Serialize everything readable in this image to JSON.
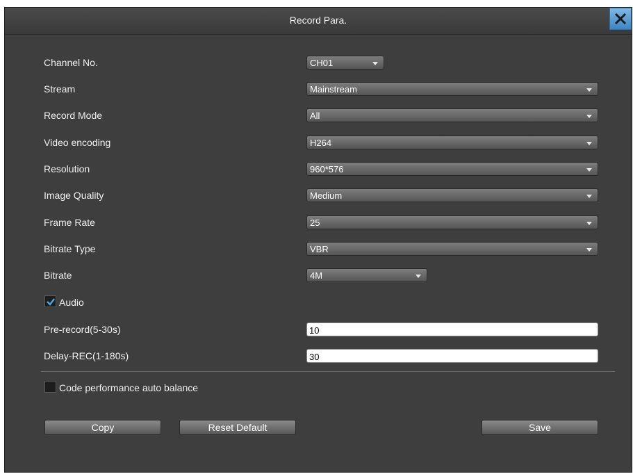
{
  "window": {
    "title": "Record Para."
  },
  "fields": {
    "channel_no": {
      "label": "Channel No.",
      "value": "CH01"
    },
    "stream": {
      "label": "Stream",
      "value": "Mainstream"
    },
    "record_mode": {
      "label": "Record Mode",
      "value": "All"
    },
    "video_encoding": {
      "label": "Video encoding",
      "value": "H264"
    },
    "resolution": {
      "label": "Resolution",
      "value": "960*576"
    },
    "image_quality": {
      "label": "Image Quality",
      "value": "Medium"
    },
    "frame_rate": {
      "label": "Frame Rate",
      "value": "25"
    },
    "bitrate_type": {
      "label": "Bitrate Type",
      "value": "VBR"
    },
    "bitrate": {
      "label": "Bitrate",
      "value": "4M"
    },
    "audio": {
      "label": "Audio",
      "checked": true
    },
    "pre_record": {
      "label": "Pre-record(5-30s)",
      "value": "10"
    },
    "delay_rec": {
      "label": "Delay-REC(1-180s)",
      "value": "30"
    },
    "code_balance": {
      "label": "Code performance auto balance",
      "checked": false
    }
  },
  "buttons": {
    "copy": "Copy",
    "reset_default": "Reset Default",
    "save": "Save"
  },
  "colors": {
    "accent": "#3d86c2",
    "check": "#4aa3e8"
  }
}
